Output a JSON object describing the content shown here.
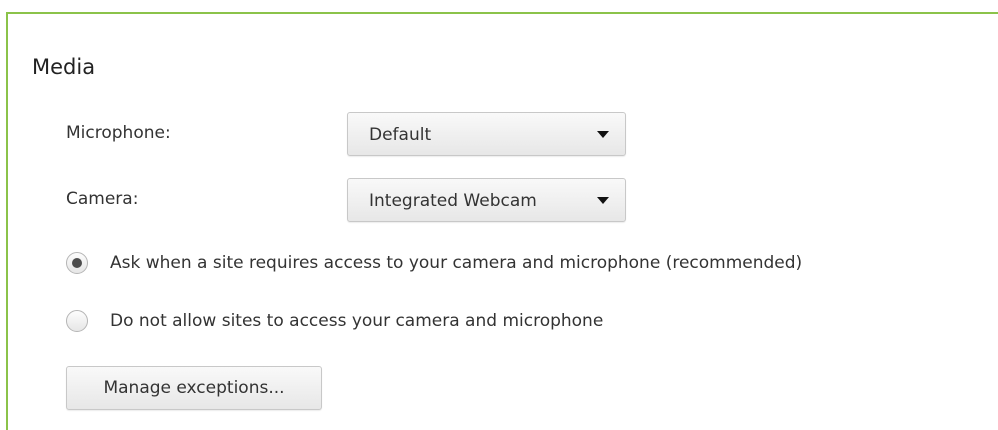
{
  "colors": {
    "frame_border": "#8bc34a",
    "text": "#333333",
    "control_border": "#c8c8c8"
  },
  "media": {
    "title": "Media",
    "microphone": {
      "label": "Microphone:",
      "selected": "Default",
      "icon": "chevron-down-icon"
    },
    "camera": {
      "label": "Camera:",
      "selected": "Integrated Webcam",
      "icon": "chevron-down-icon"
    },
    "options": [
      {
        "label": "Ask when a site requires access to your camera and microphone (recommended)",
        "checked": true
      },
      {
        "label": "Do not allow sites to access your camera and microphone",
        "checked": false
      }
    ],
    "manage_exceptions_label": "Manage exceptions..."
  }
}
